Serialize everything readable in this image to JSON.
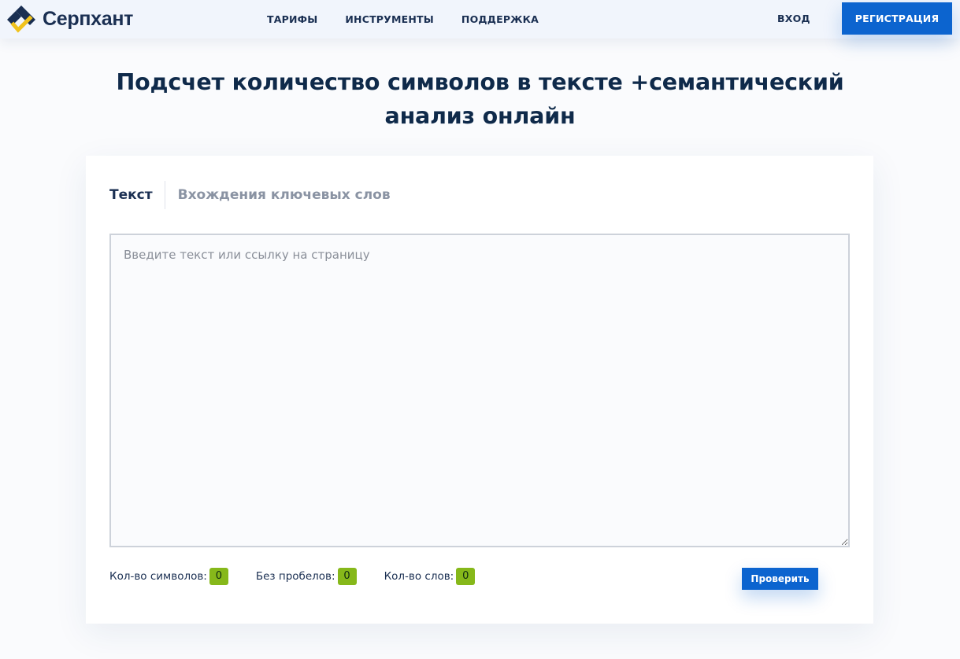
{
  "brand": {
    "name": "Серпхант",
    "colors": {
      "dark": "#1a2f52",
      "accent": "#f0c21c",
      "primary": "#0c64cf",
      "badge": "#86b81a"
    }
  },
  "nav": {
    "items": [
      {
        "label": "ТАРИФЫ"
      },
      {
        "label": "ИНСТРУМЕНТЫ"
      },
      {
        "label": "ПОДДЕРЖКА"
      }
    ],
    "login_label": "ВХОД",
    "register_label": "РЕГИСТРАЦИЯ"
  },
  "page": {
    "title": "Подсчет количество символов в тексте +семантический анализ онлайн"
  },
  "tool": {
    "tabs": [
      {
        "label": "Текст",
        "active": true
      },
      {
        "label": "Вхождения ключевых слов",
        "active": false
      }
    ],
    "textarea": {
      "value": "",
      "placeholder": "Введите текст или ссылку на страницу"
    },
    "stats": [
      {
        "label": "Кол-во символов:",
        "value": "0"
      },
      {
        "label": "Без пробелов:",
        "value": "0"
      },
      {
        "label": "Кол-во слов:",
        "value": "0"
      }
    ],
    "submit_label": "Проверить"
  }
}
